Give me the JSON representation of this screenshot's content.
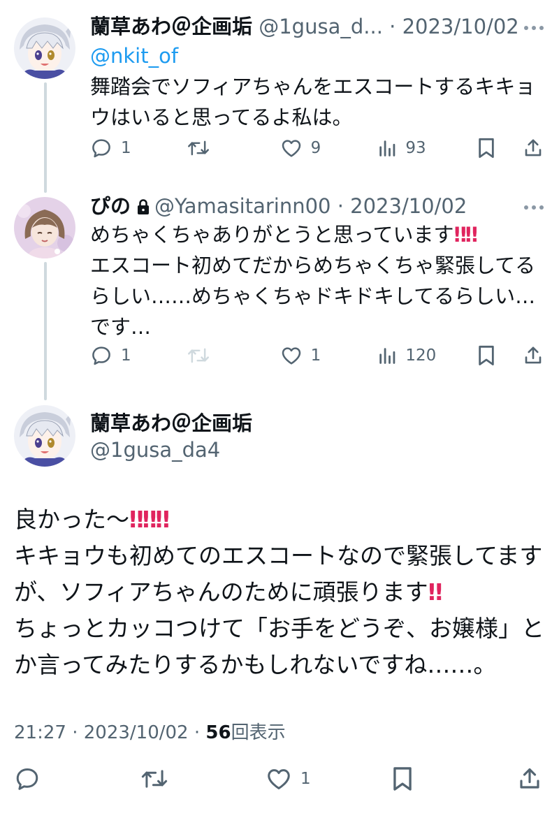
{
  "tweet1": {
    "name": "蘭草あわ＠企画垢",
    "handle": "@1gusa_d...",
    "sep": " · ",
    "date": "2023/10/02",
    "mention": "@nkit_of",
    "lines": [
      "舞踏会でソフィアちゃんをエスコートするキキョ",
      "ウはいると思ってるよ私は。"
    ],
    "replies": "1",
    "likes": "9",
    "views": "93"
  },
  "tweet2": {
    "name": "ぴの",
    "handle": "@Yamasitarinn00",
    "sep": " · ",
    "date": "2023/10/02",
    "line1": "めちゃくちゃありがとうと思っています",
    "line2": "エスコート初めてだからめちゃくちゃ緊張してる",
    "line3": "らしい……めちゃくちゃドキドキしてるらしい…",
    "line4": "です…",
    "replies": "1",
    "likes": "1",
    "views": "120"
  },
  "main": {
    "name": "蘭草あわ＠企画垢",
    "handle": "@1gusa_da4",
    "line1": "良かった〜",
    "line2": "キキョウも初めてのエスコートなので緊張してます",
    "line3": "が、ソフィアちゃんのために頑張ります",
    "line4": "ちょっとカッコつけて「お手をどうぞ、お嬢様」と",
    "line5": "か言ってみたりするかもしれないですね……。",
    "time": "21:27",
    "sep": " · ",
    "date": "2023/10/02",
    "views_count": "56",
    "views_label": "回表示",
    "likes": "1"
  },
  "emoji": {
    "double_exclamation": "‼"
  },
  "colors": {
    "accent": "#1d9bf0",
    "muted": "#536471",
    "emoji_red": "#e0245e"
  }
}
